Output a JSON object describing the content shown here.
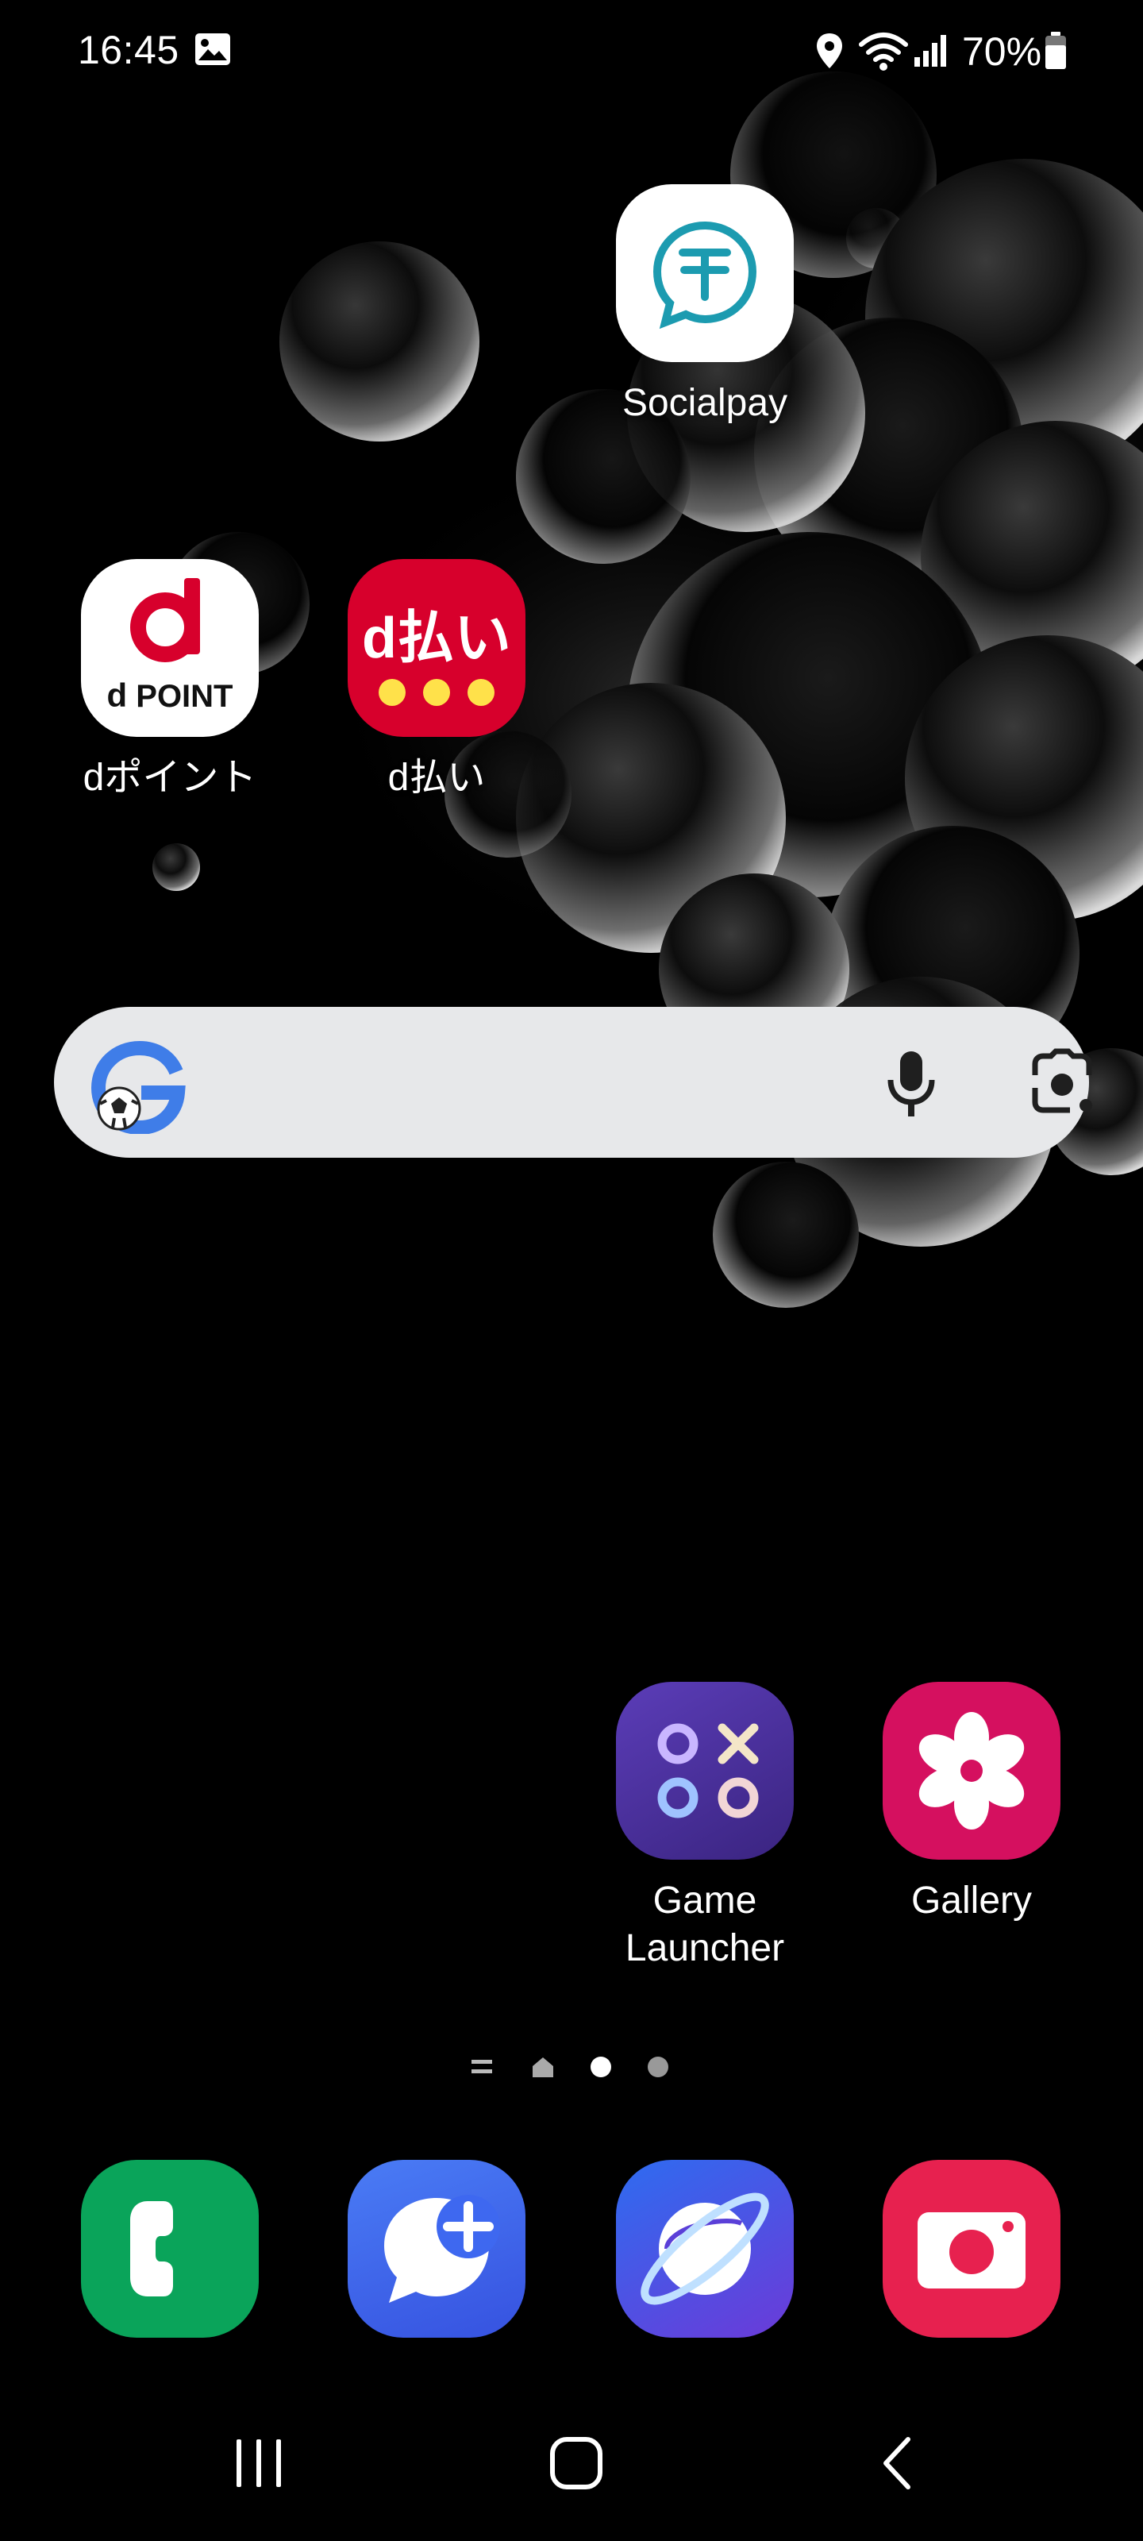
{
  "status_bar": {
    "time": "16:45",
    "battery_percent": "70%",
    "icons": [
      "gallery-notification-icon",
      "location-icon",
      "wifi-icon",
      "signal-icon",
      "battery-icon"
    ]
  },
  "home": {
    "apps": [
      {
        "id": "socialpay",
        "label": "Socialpay",
        "icon": "socialpay-icon"
      },
      {
        "id": "dpoint",
        "label": "dポイント",
        "icon": "dpoint-icon",
        "icon_text_top": "d",
        "icon_text_bottom": "POINT"
      },
      {
        "id": "dbarai",
        "label": "d払い",
        "icon": "dbarai-icon",
        "icon_text": "d払い"
      },
      {
        "id": "game-launcher",
        "label_line1": "Game",
        "label_line2": "Launcher",
        "icon": "game-launcher-icon"
      },
      {
        "id": "gallery",
        "label": "Gallery",
        "icon": "gallery-flower-icon"
      }
    ],
    "search_widget": {
      "logo": "google-g-logo-with-soccer-ball",
      "buttons": [
        "microphone-icon",
        "google-lens-icon"
      ]
    },
    "page_indicator": [
      "list-indicator",
      "home-indicator",
      "current-page-dot",
      "page-dot"
    ]
  },
  "dock": [
    {
      "id": "phone",
      "icon": "phone-icon",
      "color": "#0aa45a"
    },
    {
      "id": "messages",
      "icon": "messages-icon",
      "color": "#3e68f0"
    },
    {
      "id": "internet",
      "icon": "internet-browser-icon",
      "color": "#4b4fe3"
    },
    {
      "id": "camera",
      "icon": "camera-icon",
      "color": "#e7214f"
    }
  ],
  "nav_bar": [
    "recent-apps-button",
    "home-button",
    "back-button"
  ],
  "colors": {
    "background": "#000000",
    "search_bar": "#e7e8ea",
    "dpoint_red": "#d7002c",
    "socialpay_teal": "#1c9bb0",
    "game_launcher_purple": "#4a2f9b",
    "gallery_pink": "#d5105f"
  }
}
